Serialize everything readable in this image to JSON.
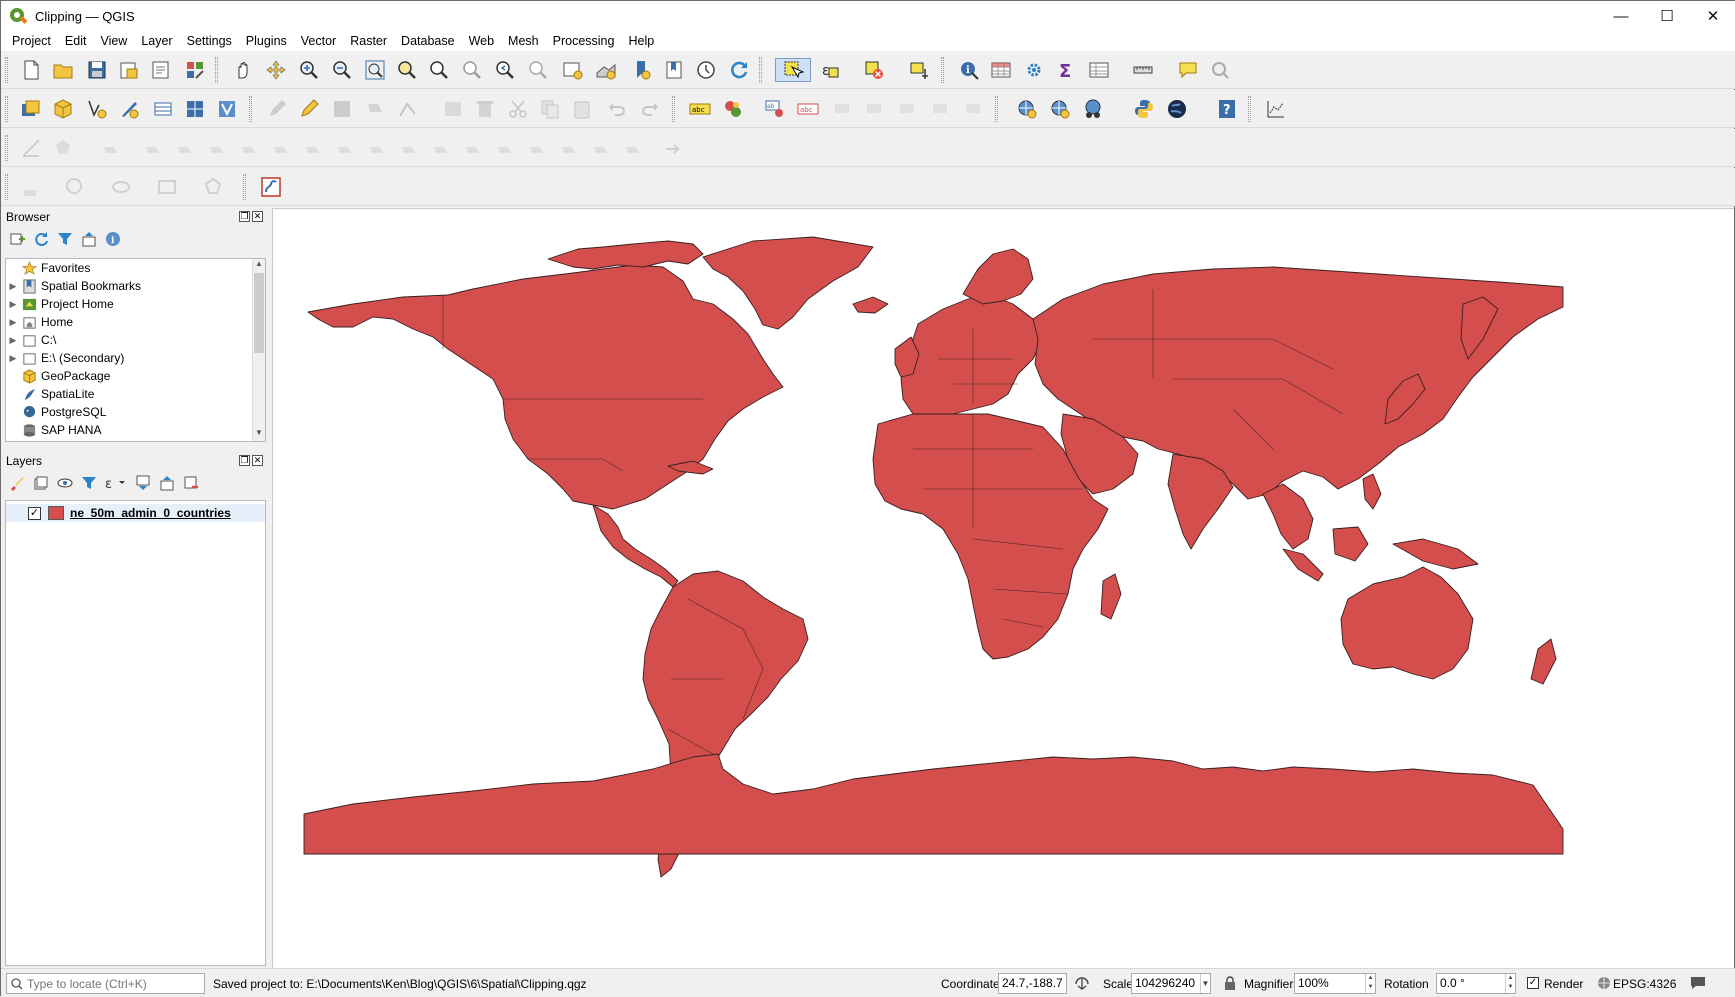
{
  "window": {
    "title": "Clipping — QGIS",
    "minimize": "—",
    "maximize": "☐",
    "close": "✕"
  },
  "menu": [
    "Project",
    "Edit",
    "View",
    "Layer",
    "Settings",
    "Plugins",
    "Vector",
    "Raster",
    "Database",
    "Web",
    "Mesh",
    "Processing",
    "Help"
  ],
  "browser": {
    "title": "Browser",
    "items": [
      {
        "label": "Favorites",
        "icon": "star-icon",
        "expandable": false
      },
      {
        "label": "Spatial Bookmarks",
        "icon": "bookmark-icon",
        "expandable": true
      },
      {
        "label": "Project Home",
        "icon": "project-home-icon",
        "expandable": true
      },
      {
        "label": "Home",
        "icon": "home-folder-icon",
        "expandable": true
      },
      {
        "label": "C:\\",
        "icon": "drive-icon",
        "expandable": true
      },
      {
        "label": "E:\\ (Secondary)",
        "icon": "drive-icon",
        "expandable": true
      },
      {
        "label": "GeoPackage",
        "icon": "geopackage-icon",
        "expandable": false
      },
      {
        "label": "SpatiaLite",
        "icon": "spatialite-icon",
        "expandable": false
      },
      {
        "label": "PostgreSQL",
        "icon": "postgresql-icon",
        "expandable": false
      },
      {
        "label": "SAP HANA",
        "icon": "sap-hana-icon",
        "expandable": false
      }
    ]
  },
  "layers": {
    "title": "Layers",
    "items": [
      {
        "name": "ne_50m_admin_0_countries",
        "visible": true,
        "color": "#d44e4e"
      }
    ]
  },
  "map": {
    "fill_color": "#d44e4e",
    "stroke_color": "#3a1f1f"
  },
  "status": {
    "locator_placeholder": "Type to locate (Ctrl+K)",
    "message": "Saved project to: E:\\Documents\\Ken\\Blog\\QGIS\\6\\Spatial\\Clipping.qgz",
    "coordinate_label": "Coordinate",
    "coordinate_value": "24.7,-188.7",
    "scale_label": "Scale",
    "scale_value": "104296240",
    "magnifier_label": "Magnifier",
    "magnifier_value": "100%",
    "rotation_label": "Rotation",
    "rotation_value": "0.0 °",
    "render_label": "Render",
    "crs": "EPSG:4326"
  },
  "colors": {
    "accent": "#589632",
    "selected": "#cde0f5"
  }
}
